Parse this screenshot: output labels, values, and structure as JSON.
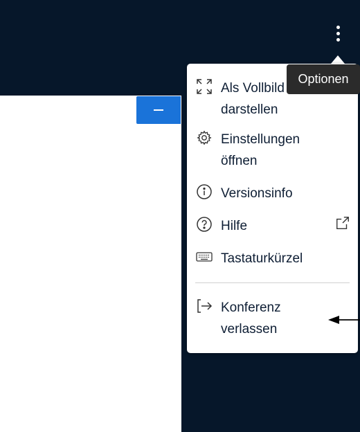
{
  "toolbar": {
    "options_tooltip": "Optionen"
  },
  "menu": {
    "items": [
      {
        "label": "Als Vollbild\ndarstellen",
        "icon": "fullscreen-icon"
      },
      {
        "label": "Einstellungen\nöffnen",
        "icon": "gear-icon"
      },
      {
        "label": "Versionsinfo",
        "icon": "info-icon"
      },
      {
        "label": "Hilfe",
        "icon": "help-icon",
        "trailing_icon": "external-link-icon"
      },
      {
        "label": "Tastaturkürzel",
        "icon": "keyboard-icon"
      },
      {
        "label": "Konferenz\nverlassen",
        "icon": "exit-icon"
      }
    ]
  },
  "colors": {
    "header_bg": "#06172a",
    "accent_blue": "#1a73d9",
    "tooltip_bg": "#2b2b2b",
    "menu_text": "#0e1e34"
  }
}
